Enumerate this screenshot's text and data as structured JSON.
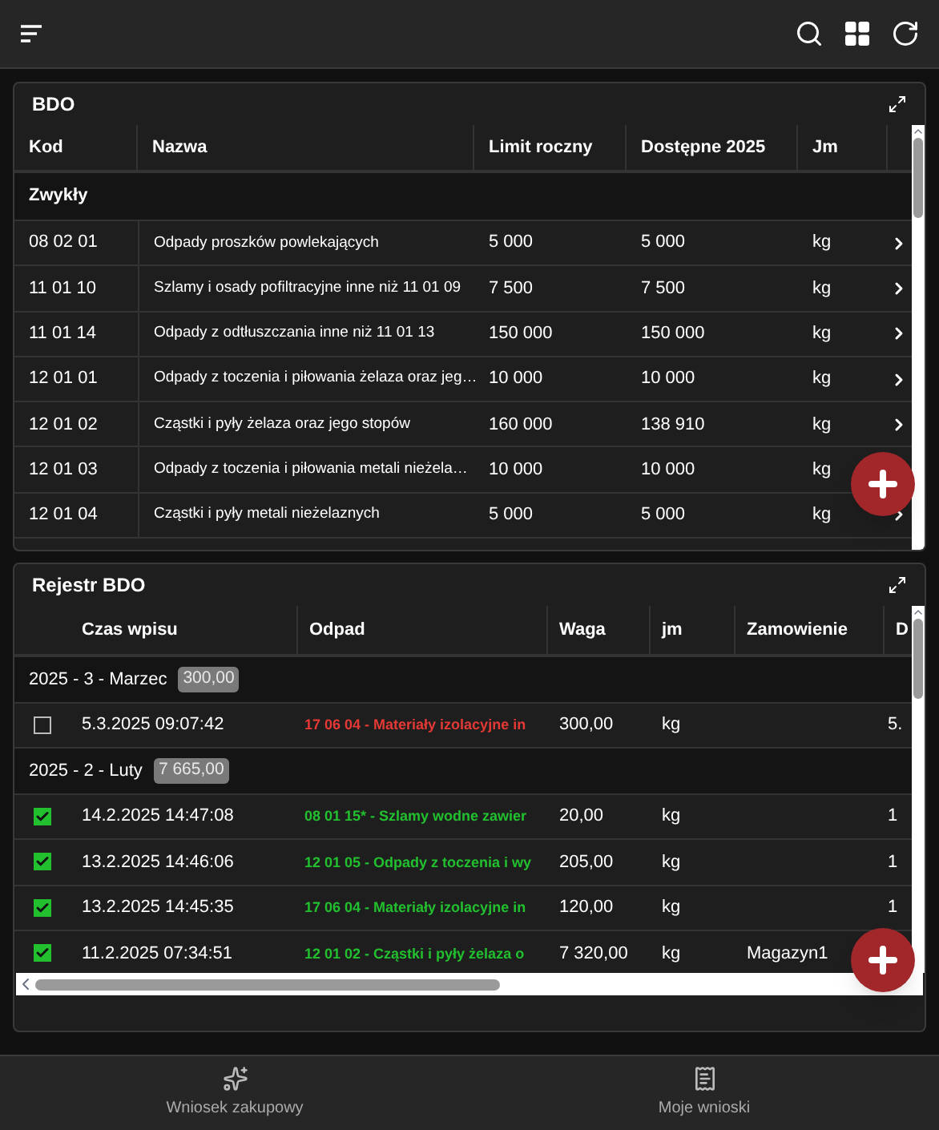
{
  "bdo": {
    "title": "BDO",
    "columns": [
      "Kod",
      "Nazwa",
      "Limit roczny",
      "Dostępne 2025",
      "Jm"
    ],
    "group": "Zwykły",
    "rows": [
      {
        "kod": "08 02 01",
        "nazwa": "Odpady proszków powlekających",
        "limit": "5 000",
        "dostepne": "5 000",
        "jm": "kg"
      },
      {
        "kod": "11 01 10",
        "nazwa": "Szlamy i osady pofiltracyjne inne niż 11 01 09",
        "limit": "7 500",
        "dostepne": "7 500",
        "jm": "kg"
      },
      {
        "kod": "11 01 14",
        "nazwa": "Odpady z odtłuszczania inne niż 11 01 13",
        "limit": "150 000",
        "dostepne": "150 000",
        "jm": "kg"
      },
      {
        "kod": "12 01 01",
        "nazwa": "Odpady z toczenia i piłowania żelaza oraz jeg…",
        "limit": "10 000",
        "dostepne": "10 000",
        "jm": "kg"
      },
      {
        "kod": "12 01 02",
        "nazwa": "Cząstki i pyły żelaza oraz jego stopów",
        "limit": "160 000",
        "dostepne": "138 910",
        "jm": "kg"
      },
      {
        "kod": "12 01 03",
        "nazwa": "Odpady z toczenia i piłowania metali nieżela…",
        "limit": "10 000",
        "dostepne": "10 000",
        "jm": "kg"
      },
      {
        "kod": "12 01 04",
        "nazwa": "Cząstki i pyły metali nieżelaznych",
        "limit": "5 000",
        "dostepne": "5 000",
        "jm": "kg"
      }
    ]
  },
  "rejestr": {
    "title": "Rejestr BDO",
    "columns": [
      "Czas wpisu",
      "Odpad",
      "Waga",
      "jm",
      "Zamowienie",
      "D"
    ],
    "groups": [
      {
        "label": "2025 - 3 - Marzec",
        "total": "300,00",
        "rows": [
          {
            "checked": false,
            "czas": "5.3.2025 09:07:42",
            "odpad": "17 06 04 - Materiały izolacyjne in",
            "color": "#e53935",
            "waga": "300,00",
            "jm": "kg",
            "column_6": "5."
          }
        ]
      },
      {
        "label": "2025 - 2 - Luty",
        "total": "7 665,00",
        "rows": [
          {
            "checked": true,
            "czas": "14.2.2025 14:47:08",
            "odpad": "08 01 15* - Szlamy wodne zawier",
            "color": "#22c02f",
            "waga": "20,00",
            "jm": "kg",
            "column_6": "1"
          },
          {
            "checked": true,
            "czas": "13.2.2025 14:46:06",
            "odpad": "12 01 05 - Odpady z toczenia i wy",
            "color": "#22c02f",
            "waga": "205,00",
            "jm": "kg",
            "column_6": "1"
          },
          {
            "checked": true,
            "czas": "13.2.2025 14:45:35",
            "odpad": "17 06 04 - Materiały izolacyjne in",
            "color": "#22c02f",
            "waga": "120,00",
            "jm": "kg",
            "column_6": "1"
          },
          {
            "checked": true,
            "czas": "11.2.2025 07:34:51",
            "odpad": "12 01 02 - Cząstki i pyły żelaza o",
            "color": "#22c02f",
            "waga": "7 320,00",
            "jm": "kg",
            "zamowienie": "Magazyn1"
          }
        ]
      }
    ]
  },
  "bottom_nav": [
    {
      "label": "Wniosek zakupowy"
    },
    {
      "label": "Moje wnioski"
    }
  ]
}
